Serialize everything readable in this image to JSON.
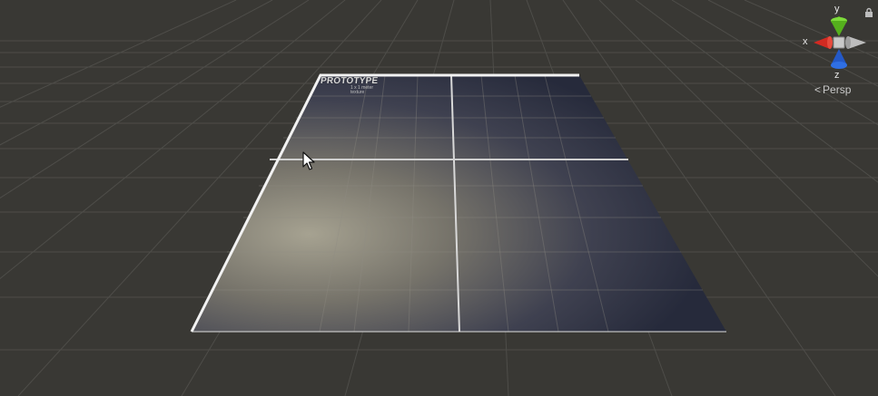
{
  "scene": {
    "view_mode": "Persp",
    "plane_texture_label": "PROTOTYPE",
    "plane_texture_sublines": [
      "1 x 1 meter",
      "texture"
    ]
  },
  "gizmo": {
    "axis_y": "y",
    "axis_x": "x",
    "axis_z": "z",
    "icons": [
      "orientation-gizmo-icon",
      "lock-icon",
      "chevron-left-icon",
      "mouse-cursor-icon"
    ]
  },
  "colors": {
    "background": "#393834",
    "grid_line": "#4e4d49",
    "axis_y": "#6fcc2a",
    "axis_x": "#d22a22",
    "axis_z": "#2a6fe0",
    "plane_light": "#9a9788",
    "plane_dark": "#2a2d3e"
  }
}
